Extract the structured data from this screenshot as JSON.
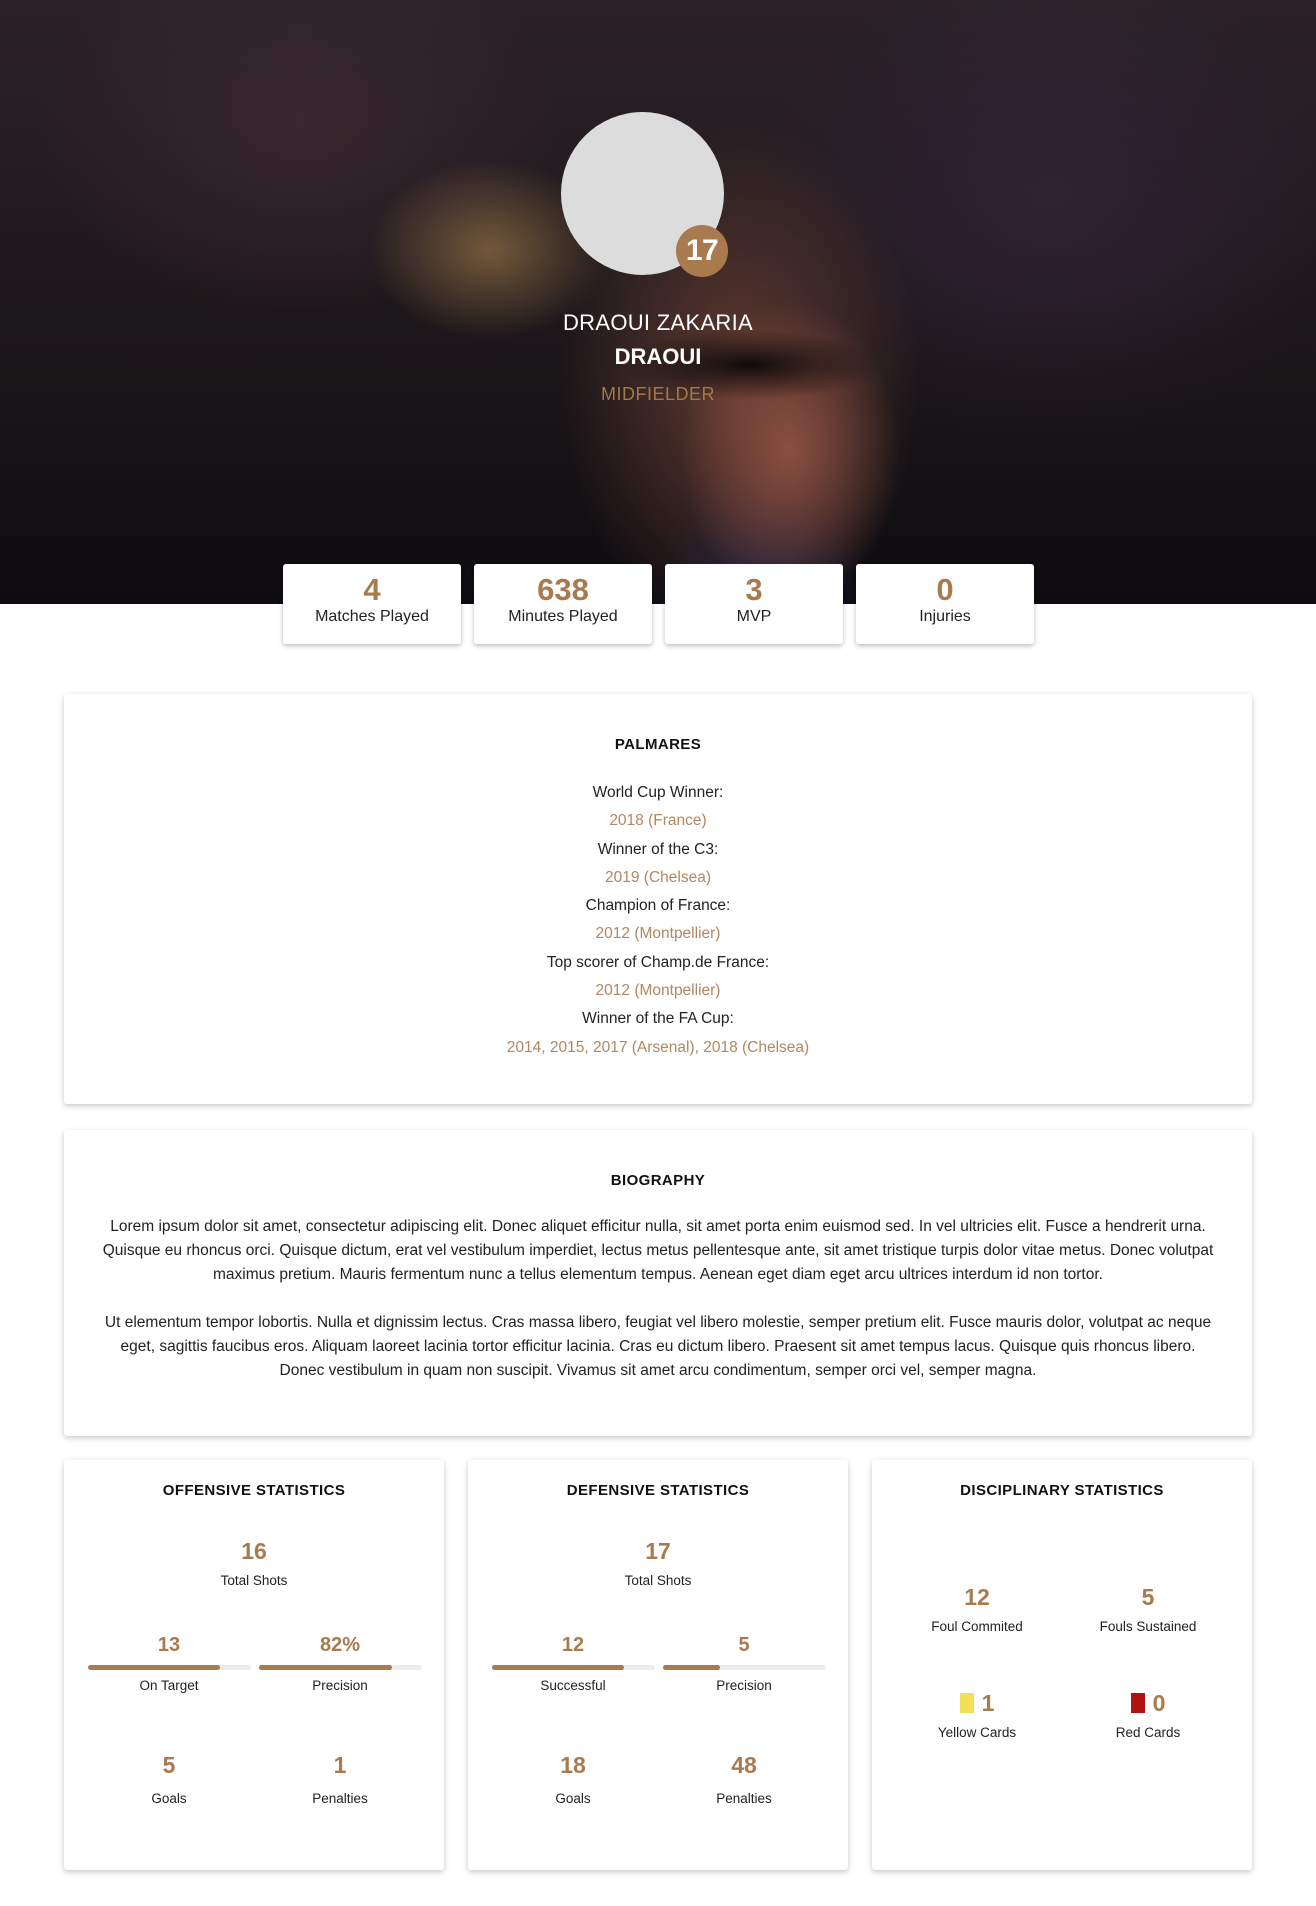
{
  "player": {
    "number": "17",
    "full_name": "DRAOUI ZAKARIA",
    "short_name": "DRAOUI",
    "position": "MIDFIELDER"
  },
  "summary": [
    {
      "value": "4",
      "label": "Matches Played"
    },
    {
      "value": "638",
      "label": "Minutes Played"
    },
    {
      "value": "3",
      "label": "MVP"
    },
    {
      "value": "0",
      "label": "Injuries"
    }
  ],
  "palmares": {
    "title": "PALMARES",
    "items": [
      {
        "label": "World Cup Winner:",
        "value": "2018 (France)"
      },
      {
        "label": "Winner of the C3:",
        "value": "2019 (Chelsea)"
      },
      {
        "label": "Champion of France:",
        "value": "2012 (Montpellier)"
      },
      {
        "label": "Top scorer of Champ.de France:",
        "value": "2012 (Montpellier)"
      },
      {
        "label": "Winner of the FA Cup:",
        "value": "2014, 2015, 2017 (Arsenal), 2018 (Chelsea)"
      }
    ]
  },
  "biography": {
    "title": "BIOGRAPHY",
    "paragraphs": [
      "Lorem ipsum dolor sit amet, consectetur adipiscing elit. Donec aliquet efficitur nulla, sit amet porta enim euismod sed. In vel ultricies elit. Fusce a hendrerit urna. Quisque eu rhoncus orci. Quisque dictum, erat vel vestibulum imperdiet, lectus metus pellentesque ante, sit amet tristique turpis dolor vitae metus. Donec volutpat maximus pretium. Mauris fermentum nunc a tellus elementum tempus. Aenean eget diam eget arcu ultrices interdum id non tortor.",
      "Ut elementum tempor lobortis. Nulla et dignissim lectus. Cras massa libero, feugiat vel libero molestie, semper pretium elit. Fusce mauris dolor, volutpat ac neque eget, sagittis faucibus eros. Aliquam laoreet lacinia tortor efficitur lacinia. Cras eu dictum libero. Praesent sit amet tempus lacus. Quisque quis rhoncus libero. Donec vestibulum in quam non suscipit. Vivamus sit amet arcu condimentum, semper orci vel, semper magna."
    ]
  },
  "offensive": {
    "title": "OFFENSIVE STATISTICS",
    "total": {
      "value": "16",
      "label": "Total Shots"
    },
    "on_target": {
      "value": "13",
      "label": "On Target",
      "progress": 0.81
    },
    "precision": {
      "value": "82%",
      "label": "Precision",
      "progress": 0.82
    },
    "goals": {
      "value": "5",
      "label": "Goals"
    },
    "penalties": {
      "value": "1",
      "label": "Penalties"
    }
  },
  "defensive": {
    "title": "DEFENSIVE STATISTICS",
    "total": {
      "value": "17",
      "label": "Total Shots"
    },
    "successful": {
      "value": "12",
      "label": "Successful",
      "progress": 0.81
    },
    "precision": {
      "value": "5",
      "label": "Precision",
      "progress": 0.35
    },
    "goals": {
      "value": "18",
      "label": "Goals"
    },
    "penalties": {
      "value": "48",
      "label": "Penalties"
    }
  },
  "disciplinary": {
    "title": "DISCIPLINARY STATISTICS",
    "fouls_committed": {
      "value": "12",
      "label": "Foul Commited"
    },
    "fouls_sustained": {
      "value": "5",
      "label": "Fouls Sustained"
    },
    "yellow": {
      "value": "1",
      "label": "Yellow Cards",
      "color": "#f2e05a"
    },
    "red": {
      "value": "0",
      "label": "Red Cards",
      "color": "#b01212"
    }
  },
  "colors": {
    "accent": "#a87a4d",
    "accent_light": "#b28761"
  }
}
